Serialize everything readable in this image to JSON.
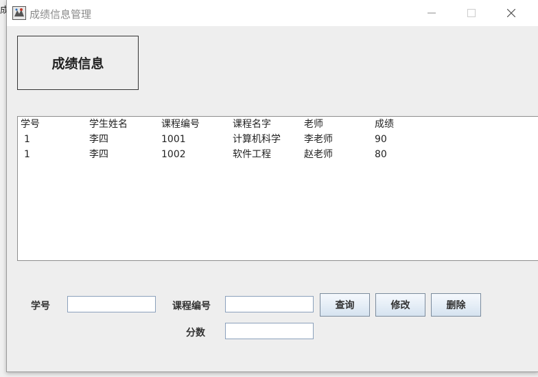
{
  "background_text": "成",
  "window": {
    "title": "成绩信息管理",
    "controls": [
      "minimize-icon",
      "maximize-icon",
      "close-icon"
    ]
  },
  "heading": "成绩信息",
  "table": {
    "columns": [
      "学号",
      "学生姓名",
      "课程编号",
      "课程名字",
      "老师",
      "成绩"
    ],
    "rows": [
      [
        "1",
        "李四",
        "1001",
        "计算机科学",
        "李老师",
        "90"
      ],
      [
        "1",
        "李四",
        "1002",
        "软件工程",
        "赵老师",
        "80"
      ]
    ]
  },
  "form": {
    "student_id_label": "学号",
    "student_id_value": "",
    "course_id_label": "课程编号",
    "course_id_value": "",
    "score_label": "分数",
    "score_value": ""
  },
  "buttons": {
    "query": "查询",
    "modify": "修改",
    "delete": "删除"
  },
  "colors": {
    "titlebar": "#ffffff",
    "window_bg": "#eeeeee",
    "button_gradient_top": "#f5f9fd",
    "button_gradient_bottom": "#d6e3f0"
  }
}
